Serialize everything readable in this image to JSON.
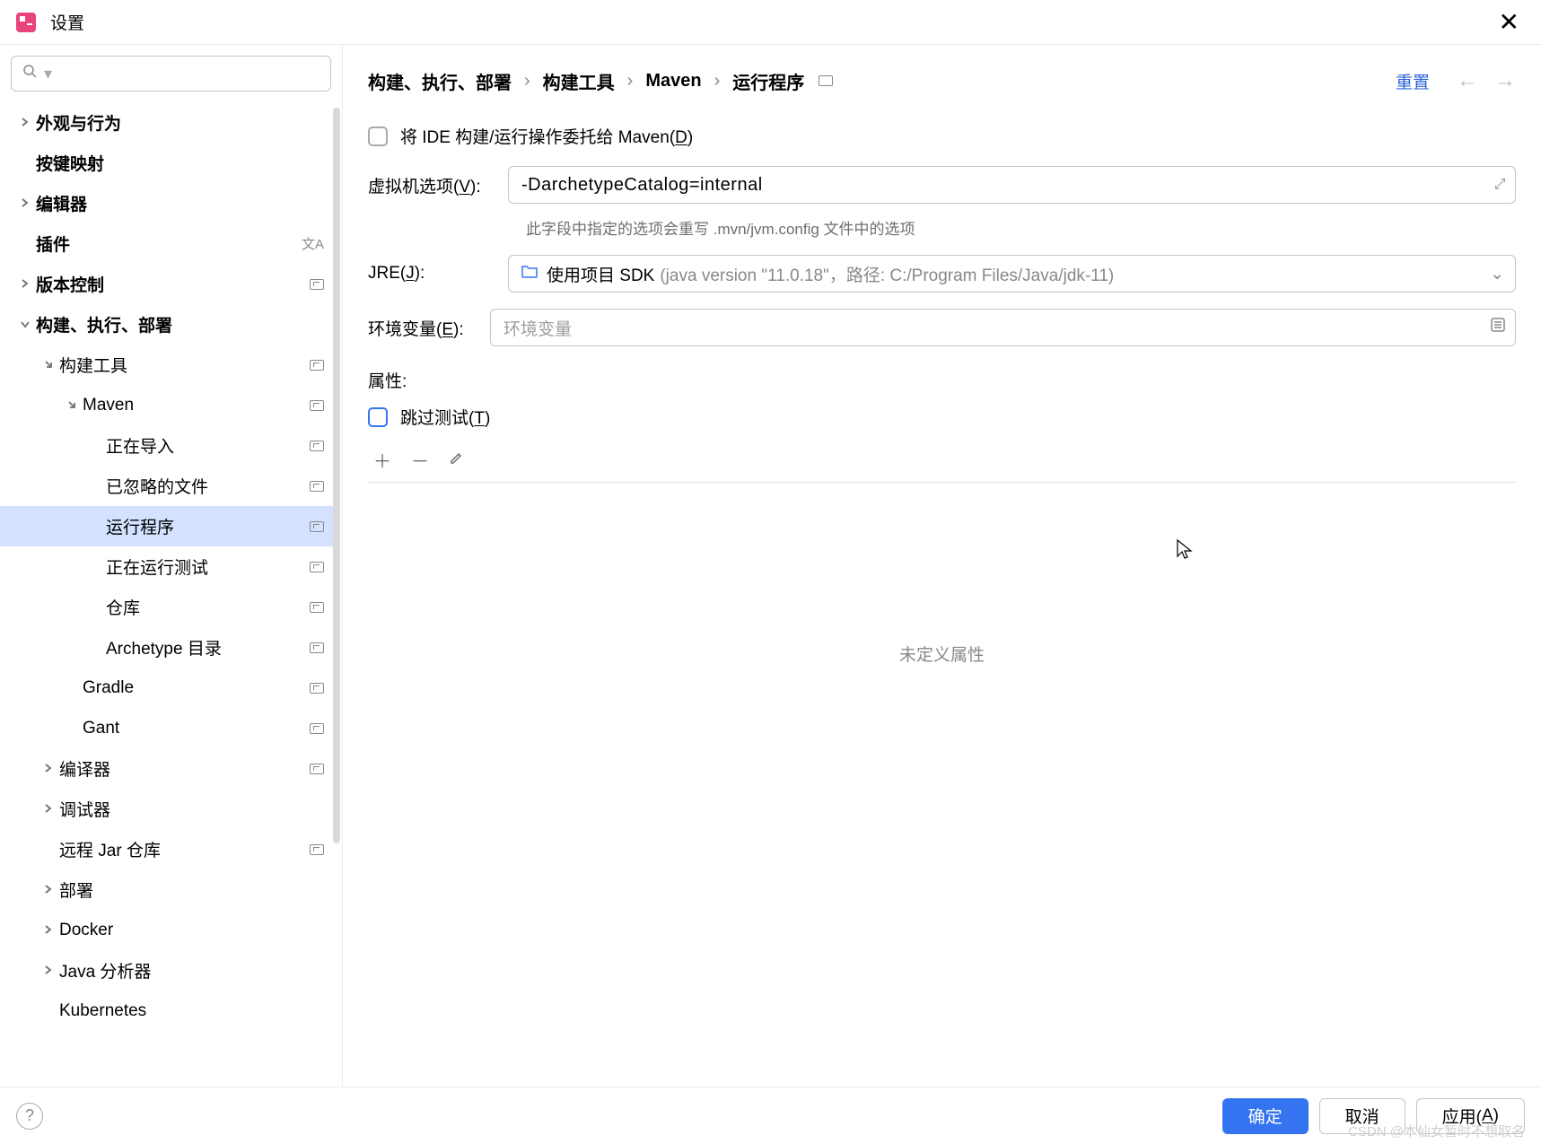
{
  "window": {
    "title": "设置"
  },
  "search": {
    "placeholder": ""
  },
  "sidebar": {
    "items": [
      {
        "label": "外观与行为",
        "level": 0,
        "arrow": "right",
        "bold": true,
        "scheme": false
      },
      {
        "label": "按键映射",
        "level": 0,
        "arrow": "",
        "bold": true,
        "scheme": false
      },
      {
        "label": "编辑器",
        "level": 0,
        "arrow": "right",
        "bold": true,
        "scheme": false
      },
      {
        "label": "插件",
        "level": 0,
        "arrow": "",
        "bold": true,
        "scheme": false,
        "lang": true
      },
      {
        "label": "版本控制",
        "level": 0,
        "arrow": "right",
        "bold": true,
        "scheme": true
      },
      {
        "label": "构建、执行、部署",
        "level": 0,
        "arrow": "down",
        "bold": true,
        "scheme": false
      },
      {
        "label": "构建工具",
        "level": 1,
        "arrow": "down-right",
        "bold": false,
        "scheme": true
      },
      {
        "label": "Maven",
        "level": 2,
        "arrow": "down-right",
        "bold": false,
        "scheme": true
      },
      {
        "label": "正在导入",
        "level": 3,
        "arrow": "",
        "bold": false,
        "scheme": true
      },
      {
        "label": "已忽略的文件",
        "level": 3,
        "arrow": "",
        "bold": false,
        "scheme": true
      },
      {
        "label": "运行程序",
        "level": 3,
        "arrow": "",
        "bold": false,
        "scheme": true,
        "selected": true
      },
      {
        "label": "正在运行测试",
        "level": 3,
        "arrow": "",
        "bold": false,
        "scheme": true
      },
      {
        "label": "仓库",
        "level": 3,
        "arrow": "",
        "bold": false,
        "scheme": true
      },
      {
        "label": "Archetype 目录",
        "level": 3,
        "arrow": "",
        "bold": false,
        "scheme": true
      },
      {
        "label": "Gradle",
        "level": 2,
        "arrow": "",
        "bold": false,
        "scheme": true
      },
      {
        "label": "Gant",
        "level": 2,
        "arrow": "",
        "bold": false,
        "scheme": true
      },
      {
        "label": "编译器",
        "level": 1,
        "arrow": "right",
        "bold": false,
        "scheme": true
      },
      {
        "label": "调试器",
        "level": 1,
        "arrow": "right",
        "bold": false,
        "scheme": false
      },
      {
        "label": "远程 Jar 仓库",
        "level": 1,
        "arrow": "",
        "bold": false,
        "scheme": true
      },
      {
        "label": "部署",
        "level": 1,
        "arrow": "right",
        "bold": false,
        "scheme": false
      },
      {
        "label": "Docker",
        "level": 1,
        "arrow": "right",
        "bold": false,
        "scheme": false
      },
      {
        "label": "Java 分析器",
        "level": 1,
        "arrow": "right",
        "bold": false,
        "scheme": false
      },
      {
        "label": "Kubernetes",
        "level": 1,
        "arrow": "",
        "bold": false,
        "scheme": false
      }
    ]
  },
  "breadcrumb": {
    "parts": [
      "构建、执行、部署",
      "构建工具",
      "Maven",
      "运行程序"
    ]
  },
  "header": {
    "reset": "重置"
  },
  "form": {
    "delegate_label_pre": "将 IDE 构建/运行操作委托给 Maven(",
    "delegate_hotkey": "D",
    "delegate_label_post": ")",
    "vm_label_pre": "虚拟机选项(",
    "vm_hotkey": "V",
    "vm_label_post": "):",
    "vm_value": "-DarchetypeCatalog=internal",
    "vm_helper": "此字段中指定的选项会重写 .mvn/jvm.config 文件中的选项",
    "jre_label_pre": "JRE(",
    "jre_hotkey": "J",
    "jre_label_post": "):",
    "jre_value": "使用项目 SDK",
    "jre_extra": "(java version \"11.0.18\"，路径: C:/Program Files/Java/jdk-11)",
    "env_label_pre": "环境变量(",
    "env_hotkey": "E",
    "env_label_post": "):",
    "env_placeholder": "环境变量",
    "props_label": "属性:",
    "skip_label_pre": "跳过测试(",
    "skip_hotkey": "T",
    "skip_label_post": ")",
    "props_empty": "未定义属性"
  },
  "footer": {
    "ok": "确定",
    "cancel": "取消",
    "apply_pre": "应用(",
    "apply_hotkey": "A",
    "apply_post": ")"
  },
  "watermark": "CSDN @本仙女暂时不想取名"
}
